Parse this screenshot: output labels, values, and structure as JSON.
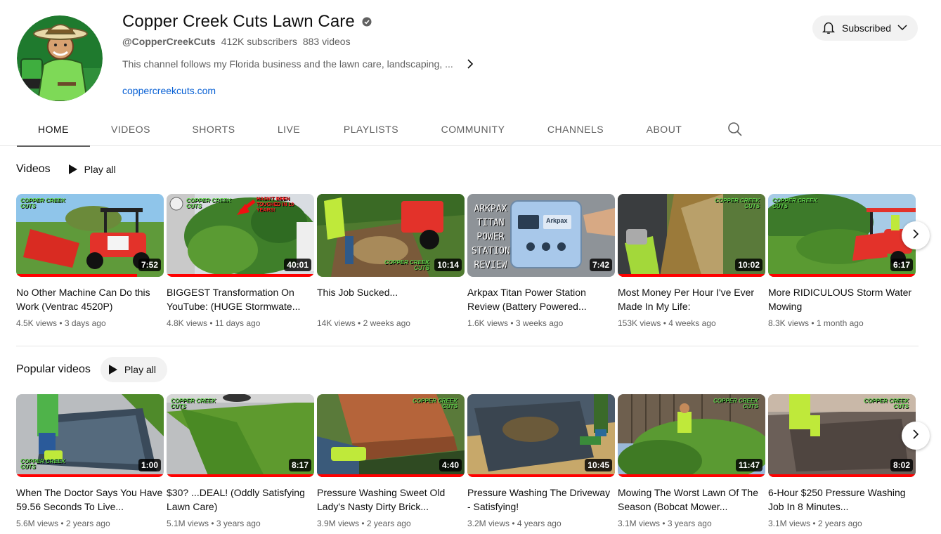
{
  "channel": {
    "name": "Copper Creek Cuts Lawn Care",
    "handle": "@CopperCreekCuts",
    "subscribers": "412K subscribers",
    "videos_count": "883 videos",
    "description": "This channel follows my Florida business and the lawn care, landscaping, ...",
    "link": "coppercreekcuts.com",
    "subscribe_label": "Subscribed"
  },
  "tabs": [
    {
      "label": "HOME"
    },
    {
      "label": "VIDEOS"
    },
    {
      "label": "SHORTS"
    },
    {
      "label": "LIVE"
    },
    {
      "label": "PLAYLISTS"
    },
    {
      "label": "COMMUNITY"
    },
    {
      "label": "CHANNELS"
    },
    {
      "label": "ABOUT"
    }
  ],
  "sections": [
    {
      "title": "Videos",
      "play_all": "Play all",
      "videos": [
        {
          "title": "No Other Machine Can Do this Work (Ventrac 4520P)",
          "views": "4.5K views",
          "age": "3 days ago",
          "duration": "7:52",
          "progress": 0.82
        },
        {
          "title": "BIGGEST Transformation On YouTube: (HUGE Stormwate...",
          "views": "4.8K views",
          "age": "11 days ago",
          "duration": "40:01",
          "progress": 1.0
        },
        {
          "title": "This Job Sucked...",
          "views": "14K views",
          "age": "2 weeks ago",
          "duration": "10:14",
          "progress": 0
        },
        {
          "title": "Arkpax Titan Power Station Review (Battery Powered...",
          "views": "1.6K views",
          "age": "3 weeks ago",
          "duration": "7:42",
          "progress": 0
        },
        {
          "title": "Most Money Per Hour I've Ever Made In My Life:",
          "views": "153K views",
          "age": "4 weeks ago",
          "duration": "10:02",
          "progress": 1.0
        },
        {
          "title": "More RIDICULOUS Storm Water Mowing",
          "views": "8.3K views",
          "age": "1 month ago",
          "duration": "6:17",
          "progress": 1.0
        }
      ]
    },
    {
      "title": "Popular videos",
      "play_all": "Play all",
      "videos": [
        {
          "title": "When The Doctor Says You Have 59.56 Seconds To Live...",
          "views": "5.6M views",
          "age": "2 years ago",
          "duration": "1:00",
          "progress": 1.0
        },
        {
          "title": "$30? ...DEAL! (Oddly Satisfying Lawn Care)",
          "views": "5.1M views",
          "age": "3 years ago",
          "duration": "8:17",
          "progress": 1.0
        },
        {
          "title": "Pressure Washing Sweet Old Lady's Nasty Dirty Brick...",
          "views": "3.9M views",
          "age": "2 years ago",
          "duration": "4:40",
          "progress": 1.0
        },
        {
          "title": "Pressure Washing The Driveway - Satisfying!",
          "views": "3.2M views",
          "age": "4 years ago",
          "duration": "10:45",
          "progress": 1.0
        },
        {
          "title": "Mowing The Worst Lawn Of The Season (Bobcat Mower...",
          "views": "3.1M views",
          "age": "3 years ago",
          "duration": "11:47",
          "progress": 1.0
        },
        {
          "title": "6-Hour $250 Pressure Washing Job In 8 Minutes...",
          "views": "3.1M views",
          "age": "2 years ago",
          "duration": "8:02",
          "progress": 1.0
        }
      ]
    }
  ],
  "thumb_text": {
    "arkpax": [
      "ARKPAX",
      "TITAN",
      "POWER",
      "STATION",
      "REVIEW"
    ],
    "brand_small": "Arkpax",
    "logo_line1": "COPPER CREEK",
    "logo_line2": "CUTS",
    "banner": "HASN'T BEEN TOUCHED IN 10 YEARS!"
  },
  "colors": {
    "accent_link": "#065fd4",
    "progress_red": "#ff0000",
    "brand_green": "#5fd04a"
  }
}
